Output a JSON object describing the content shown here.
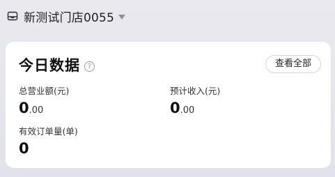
{
  "store": {
    "name": "新测试门店0055",
    "icon": "store-icon"
  },
  "card": {
    "title": "今日数据",
    "help_icon": "question-icon",
    "help_glyph": "?",
    "view_all_label": "查看全部",
    "metrics": [
      {
        "label": "总营业额(元)",
        "int": "0",
        "dec": ".00"
      },
      {
        "label": "预计收入(元)",
        "int": "0",
        "dec": ".00"
      },
      {
        "label": "有效订单量(单)",
        "int": "0"
      }
    ]
  }
}
